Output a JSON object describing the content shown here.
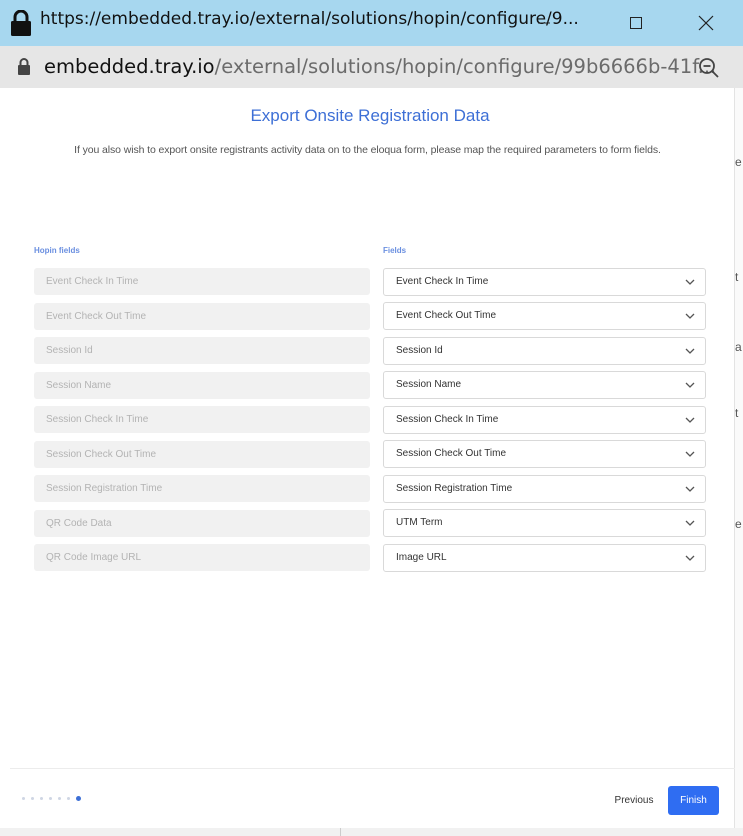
{
  "window": {
    "title": "https://embedded.tray.io/external/solutions/hopin/configure/9...",
    "address_host": "embedded.tray.io",
    "address_path": "/external/solutions/hopin/configure/99b6666b-41f..."
  },
  "modal": {
    "title": "Export Onsite Registration Data",
    "subtitle": "If you also wish to export onsite registrants activity data on to the eloqua form, please map the required parameters to form fields.",
    "left_column_label": "Hopin fields",
    "right_column_label": "Fields",
    "rows": [
      {
        "hopin": "Event Check In Time",
        "field": "Event Check In Time"
      },
      {
        "hopin": "Event Check Out Time",
        "field": "Event Check Out Time"
      },
      {
        "hopin": "Session Id",
        "field": "Session Id"
      },
      {
        "hopin": "Session Name",
        "field": "Session Name"
      },
      {
        "hopin": "Session Check In Time",
        "field": "Session Check In Time"
      },
      {
        "hopin": "Session Check Out Time",
        "field": "Session Check Out Time"
      },
      {
        "hopin": "Session Registration Time",
        "field": "Session Registration Time"
      },
      {
        "hopin": "QR Code Data",
        "field": "UTM Term"
      },
      {
        "hopin": "QR Code Image URL",
        "field": "Image URL"
      }
    ]
  },
  "footer": {
    "previous_label": "Previous",
    "finish_label": "Finish",
    "steps_total": 7,
    "current_step": 7
  },
  "background": {
    "glyphs": [
      "t",
      "a",
      "t",
      "e",
      "e"
    ]
  },
  "colors": {
    "titlebar": "#a7d7ef",
    "accent": "#2f6df2",
    "title_text": "#3d6fd6"
  }
}
